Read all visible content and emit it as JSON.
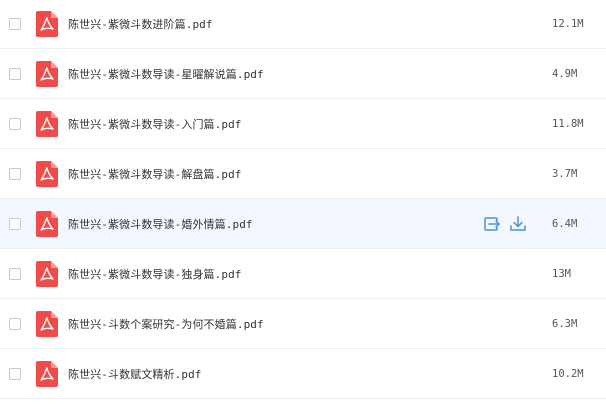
{
  "files": [
    {
      "name": "陈世兴-紫微斗数进阶篇.pdf",
      "size": "12.1M"
    },
    {
      "name": "陈世兴-紫微斗数导读-星曜解说篇.pdf",
      "size": "4.9M"
    },
    {
      "name": "陈世兴-紫微斗数导读-入门篇.pdf",
      "size": "11.8M"
    },
    {
      "name": "陈世兴-紫微斗数导读-解盘篇.pdf",
      "size": "3.7M"
    },
    {
      "name": "陈世兴-紫微斗数导读-婚外情篇.pdf",
      "size": "6.4M"
    },
    {
      "name": "陈世兴-紫微斗数导读-独身篇.pdf",
      "size": "13M"
    },
    {
      "name": "陈世兴-斗数个案研究-为何不婚篇.pdf",
      "size": "6.3M"
    },
    {
      "name": "陈世兴-斗数赋文精析.pdf",
      "size": "10.2M"
    }
  ],
  "hovered_row": 4,
  "colors": {
    "pdf_icon": "#f04b4b",
    "action_icon": "#4a90d9",
    "hover_bg": "#f3f8fe",
    "border": "#eceef2"
  },
  "icons": {
    "file": "pdf-file-icon",
    "share": "share-icon",
    "download": "download-icon"
  }
}
